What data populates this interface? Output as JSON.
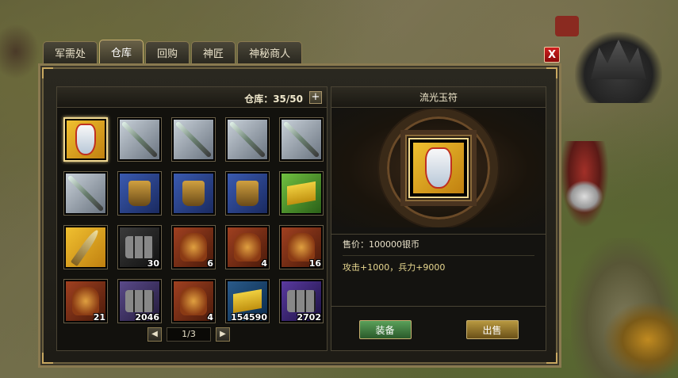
{
  "tabs": [
    {
      "label": "军需处",
      "active": false
    },
    {
      "label": "仓库",
      "active": true
    },
    {
      "label": "回购",
      "active": false
    },
    {
      "label": "神匠",
      "active": false
    },
    {
      "label": "神秘商人",
      "active": false
    }
  ],
  "close_label": "X",
  "warehouse": {
    "capacity_text": "仓库：35/50",
    "expand_label": "+",
    "items": [
      {
        "name": "jade-pendant",
        "count": "",
        "bg": "gold",
        "icon": "jade-pendant",
        "selected": true
      },
      {
        "name": "spear",
        "count": "",
        "bg": "silver",
        "icon": "spear"
      },
      {
        "name": "spear",
        "count": "",
        "bg": "silver",
        "icon": "spear"
      },
      {
        "name": "spear",
        "count": "",
        "bg": "silver",
        "icon": "spear"
      },
      {
        "name": "spear",
        "count": "",
        "bg": "silver",
        "icon": "spear"
      },
      {
        "name": "spear",
        "count": "",
        "bg": "silver",
        "icon": "spear"
      },
      {
        "name": "boots",
        "count": "",
        "bg": "blue",
        "icon": "boots"
      },
      {
        "name": "boots",
        "count": "",
        "bg": "blue",
        "icon": "boots"
      },
      {
        "name": "boots",
        "count": "",
        "bg": "blue",
        "icon": "boots"
      },
      {
        "name": "flag",
        "count": "",
        "bg": "green",
        "icon": "flag"
      },
      {
        "name": "blade",
        "count": "",
        "bg": "gold",
        "icon": "blade"
      },
      {
        "name": "iron-bars",
        "count": "30",
        "bg": "dark",
        "icon": "bars"
      },
      {
        "name": "armor",
        "count": "6",
        "bg": "red",
        "icon": "armor"
      },
      {
        "name": "armor",
        "count": "4",
        "bg": "red",
        "icon": "armor"
      },
      {
        "name": "armor",
        "count": "16",
        "bg": "red",
        "icon": "armor"
      },
      {
        "name": "armor",
        "count": "21",
        "bg": "red",
        "icon": "armor"
      },
      {
        "name": "ore",
        "count": "2046",
        "bg": "purple",
        "icon": "bars"
      },
      {
        "name": "armor",
        "count": "4",
        "bg": "red",
        "icon": "armor"
      },
      {
        "name": "scroll",
        "count": "154590",
        "bg": "scroll",
        "icon": "flag"
      },
      {
        "name": "card",
        "count": "2702",
        "bg": "card",
        "icon": "bars"
      }
    ],
    "pager": {
      "prev": "◀",
      "page": "1/3",
      "next": "▶"
    }
  },
  "detail": {
    "title": "流光玉符",
    "price": "售价：100000银币",
    "stats": "攻击+1000，兵力+9000",
    "equip_label": "装备",
    "sell_label": "出售"
  }
}
